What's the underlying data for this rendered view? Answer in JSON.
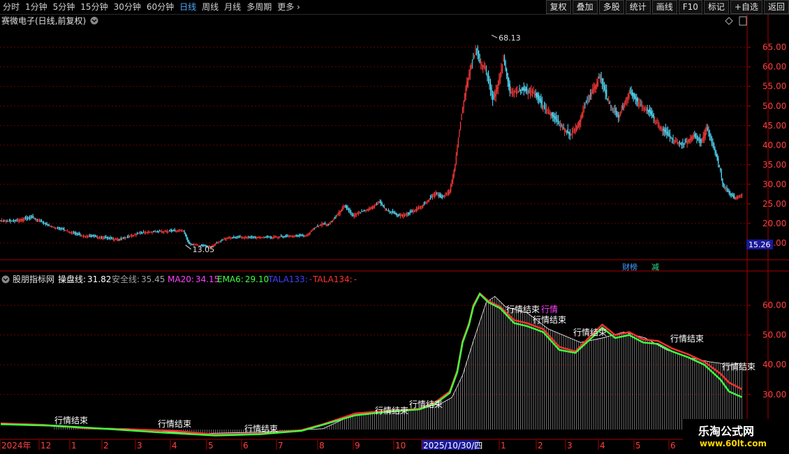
{
  "toolbar": {
    "periods": [
      "分时",
      "1分钟",
      "5分钟",
      "15分钟",
      "30分钟",
      "60分钟",
      "日线",
      "周线",
      "月线",
      "多周期",
      "更多"
    ],
    "active_period": "日线",
    "more_arrow": "chevron-right-icon",
    "buttons": [
      "复权",
      "叠加",
      "多股",
      "统计",
      "画线",
      "F10",
      "标记",
      "+自选",
      "返回"
    ]
  },
  "main_panel": {
    "title": "赛微电子(日线,前复权)",
    "title_icon": "chevron-down-icon",
    "corner_icon": "diamond-icon",
    "high_label": "68.13",
    "low_label": "13.05",
    "current_price": "15.26",
    "badges": [
      {
        "text": "财榜",
        "color": "#3fa0ff"
      },
      {
        "text": "减",
        "color": "#31e08d"
      }
    ],
    "colors": {
      "up": "#ff3b3b",
      "down": "#56e0ff",
      "grid": "#6b0000"
    }
  },
  "indicator_panel": {
    "icon": "chevron-down-icon",
    "name": "股朋指标网",
    "legend": [
      {
        "label": "操盘线:",
        "value": "31.82",
        "color": "#ffffff"
      },
      {
        "label": "安全线:",
        "value": "35.45",
        "color": "#a0a0a0"
      },
      {
        "label": "MA20:",
        "value": "34.15",
        "color": "#ff40ff"
      },
      {
        "label": "EMA6:",
        "value": "29.10",
        "color": "#40ff40"
      },
      {
        "label": "TALA133:",
        "value": "-",
        "color": "#4040ff"
      },
      {
        "label": "TALA134:",
        "value": "-",
        "color": "#ff3030"
      }
    ],
    "annotations": [
      "行情结束",
      "行情"
    ]
  },
  "chart_data": [
    {
      "type": "candlestick",
      "y_ticks": [
        15,
        20,
        25,
        30,
        35,
        40,
        45,
        50,
        55,
        60,
        65
      ],
      "ylim": [
        10.7,
        70.3
      ],
      "close_path": [
        [
          0,
          20.8
        ],
        [
          10,
          20.5
        ],
        [
          22,
          21.2
        ],
        [
          30,
          21.5
        ],
        [
          45,
          19.4
        ],
        [
          60,
          18.3
        ],
        [
          75,
          16.9
        ],
        [
          90,
          16.6
        ],
        [
          100,
          16.2
        ],
        [
          112,
          15.9
        ],
        [
          118,
          16.6
        ],
        [
          130,
          17.6
        ],
        [
          150,
          18.0
        ],
        [
          170,
          18.2
        ],
        [
          175,
          14.8
        ],
        [
          195,
          14.0
        ],
        [
          210,
          16.3
        ],
        [
          225,
          16.5
        ],
        [
          235,
          16.4
        ],
        [
          255,
          16.5
        ],
        [
          270,
          16.8
        ],
        [
          285,
          16.9
        ],
        [
          290,
          18.4
        ],
        [
          300,
          20.1
        ],
        [
          305,
          19.5
        ],
        [
          320,
          24.5
        ],
        [
          328,
          22.0
        ],
        [
          345,
          24.0
        ],
        [
          352,
          25.5
        ],
        [
          360,
          23.3
        ],
        [
          370,
          22.0
        ],
        [
          380,
          22.5
        ],
        [
          395,
          25.0
        ],
        [
          405,
          28.0
        ],
        [
          410,
          26.5
        ],
        [
          418,
          28.3
        ],
        [
          420,
          31.0
        ],
        [
          423,
          35.0
        ],
        [
          428,
          46.0
        ],
        [
          433,
          55.0
        ],
        [
          438,
          60.5
        ],
        [
          443,
          64.5
        ],
        [
          446,
          61.0
        ],
        [
          451,
          60.0
        ],
        [
          458,
          51.5
        ],
        [
          463,
          55.5
        ],
        [
          468,
          62.0
        ],
        [
          474,
          53.5
        ],
        [
          485,
          54.0
        ],
        [
          495,
          53.8
        ],
        [
          505,
          50.0
        ],
        [
          520,
          45.5
        ],
        [
          530,
          42.5
        ],
        [
          537,
          45.0
        ],
        [
          545,
          51.0
        ],
        [
          558,
          57.5
        ],
        [
          565,
          51.5
        ],
        [
          575,
          47.0
        ],
        [
          585,
          53.5
        ],
        [
          595,
          50.5
        ],
        [
          605,
          48.0
        ],
        [
          615,
          44.3
        ],
        [
          625,
          41.5
        ],
        [
          635,
          40.0
        ],
        [
          645,
          42.5
        ],
        [
          652,
          40.5
        ],
        [
          657,
          44.8
        ],
        [
          665,
          38.0
        ],
        [
          670,
          33.5
        ],
        [
          672,
          30.0
        ],
        [
          677,
          28.0
        ],
        [
          683,
          26.5
        ],
        [
          690,
          27.3
        ]
      ],
      "high_marker": {
        "x": 457,
        "value": 68.13
      },
      "low_marker": {
        "x": 172,
        "value": 13.05
      }
    },
    {
      "type": "line",
      "y_ticks": [
        30,
        40,
        50,
        60
      ],
      "ylim": [
        18.2,
        70.6
      ],
      "series": [
        {
          "name": "操盘线",
          "color": "#ffffff",
          "values": [
            [
              0,
              20.5
            ],
            [
              60,
              19.0
            ],
            [
              120,
              18.5
            ],
            [
              180,
              16.8
            ],
            [
              240,
              17.3
            ],
            [
              300,
              18.5
            ],
            [
              330,
              23.5
            ],
            [
              360,
              24.6
            ],
            [
              390,
              25.2
            ],
            [
              410,
              27.0
            ],
            [
              420,
              29.0
            ],
            [
              430,
              36.5
            ],
            [
              440,
              48.0
            ],
            [
              452,
              61.0
            ],
            [
              460,
              63.0
            ],
            [
              470,
              59.5
            ],
            [
              490,
              57.5
            ],
            [
              510,
              52.0
            ],
            [
              540,
              47.5
            ],
            [
              560,
              49.0
            ],
            [
              580,
              51.0
            ],
            [
              600,
              49.0
            ],
            [
              620,
              45.0
            ],
            [
              640,
              42.5
            ],
            [
              660,
              41.0
            ],
            [
              680,
              40.0
            ],
            [
              690,
              40.5
            ]
          ]
        },
        {
          "name": "MA20",
          "color": "#ff3030",
          "values": [
            [
              0,
              20.3
            ],
            [
              40,
              19.8
            ],
            [
              80,
              18.6
            ],
            [
              120,
              18.3
            ],
            [
              160,
              17.8
            ],
            [
              200,
              16.5
            ],
            [
              240,
              16.8
            ],
            [
              280,
              18.0
            ],
            [
              300,
              20.0
            ],
            [
              330,
              23.6
            ],
            [
              360,
              24.5
            ],
            [
              390,
              25.2
            ],
            [
              405,
              27.5
            ],
            [
              418,
              31.0
            ],
            [
              425,
              38.0
            ],
            [
              430,
              48.0
            ],
            [
              436,
              54.0
            ],
            [
              440,
              60.0
            ],
            [
              446,
              64.0
            ],
            [
              454,
              61.5
            ],
            [
              465,
              59.5
            ],
            [
              478,
              55.0
            ],
            [
              490,
              54.0
            ],
            [
              505,
              52.0
            ],
            [
              520,
              46.0
            ],
            [
              535,
              44.5
            ],
            [
              550,
              50.0
            ],
            [
              560,
              53.5
            ],
            [
              572,
              50.0
            ],
            [
              585,
              51.0
            ],
            [
              598,
              48.5
            ],
            [
              612,
              48.0
            ],
            [
              625,
              45.5
            ],
            [
              640,
              43.5
            ],
            [
              655,
              41.0
            ],
            [
              670,
              37.0
            ],
            [
              678,
              34.0
            ],
            [
              690,
              31.8
            ]
          ]
        },
        {
          "name": "EMA6",
          "color": "#40ff40",
          "values": [
            [
              0,
              20.0
            ],
            [
              50,
              19.5
            ],
            [
              100,
              18.4
            ],
            [
              150,
              17.2
            ],
            [
              200,
              16.2
            ],
            [
              240,
              16.6
            ],
            [
              280,
              17.8
            ],
            [
              300,
              19.8
            ],
            [
              330,
              23.0
            ],
            [
              360,
              24.2
            ],
            [
              390,
              25.0
            ],
            [
              405,
              27.0
            ],
            [
              418,
              30.5
            ],
            [
              425,
              37.5
            ],
            [
              430,
              47.5
            ],
            [
              436,
              53.5
            ],
            [
              440,
              59.5
            ],
            [
              446,
              63.8
            ],
            [
              454,
              61.0
            ],
            [
              465,
              59.0
            ],
            [
              478,
              54.0
            ],
            [
              490,
              53.0
            ],
            [
              505,
              51.0
            ],
            [
              520,
              45.0
            ],
            [
              535,
              44.0
            ],
            [
              550,
              49.0
            ],
            [
              560,
              52.5
            ],
            [
              572,
              49.0
            ],
            [
              585,
              50.0
            ],
            [
              598,
              47.5
            ],
            [
              612,
              47.0
            ],
            [
              625,
              44.5
            ],
            [
              640,
              42.5
            ],
            [
              655,
              40.0
            ],
            [
              670,
              35.0
            ],
            [
              678,
              31.0
            ],
            [
              690,
              29.1
            ]
          ]
        }
      ]
    }
  ],
  "x_axis": {
    "labels": [
      "2024年",
      "12",
      "1",
      "2",
      "3",
      "4",
      "5",
      "6",
      "7",
      "8",
      "9",
      "10",
      "2025/10/30/四",
      "1",
      "2",
      "3",
      "4",
      "5",
      "6"
    ]
  },
  "watermark": {
    "line1": "乐淘公式网",
    "line2": "www.60lt.com"
  }
}
